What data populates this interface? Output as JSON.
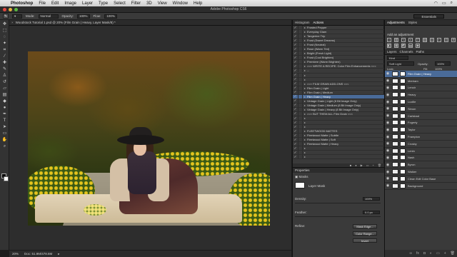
{
  "menubar": {
    "app_name": "Photoshop",
    "items": [
      "File",
      "Edit",
      "Image",
      "Layer",
      "Type",
      "Select",
      "Filter",
      "3D",
      "View",
      "Window",
      "Help"
    ]
  },
  "window": {
    "title": "Adobe Photoshop CS6"
  },
  "options_bar": {
    "mode_label": "Mode:",
    "mode_value": "Normal",
    "opacity_label": "Opacity:",
    "opacity_value": "100%",
    "flow_label": "Flow:",
    "flow_value": "100%",
    "workspace": "Essentials"
  },
  "document": {
    "tab_title": "Woodstock Tutorial 1.psd @ 20% (Film Grain | Heavy, Layer Mask/8) *"
  },
  "status_bar": {
    "zoom": "20%",
    "doc_size": "Doc: 51.9M/478.6M"
  },
  "actions_panel": {
    "tabs": [
      "Histogram",
      "Actions"
    ],
    "rows": [
      {
        "label": "Frosted Pepper"
      },
      {
        "label": "Everyday Glam"
      },
      {
        "label": "Tangerine Trip"
      },
      {
        "label": "Frost (Sweet Dreams)"
      },
      {
        "label": "Frost (Neutral)"
      },
      {
        "label": "Rose (Warm Tint)"
      },
      {
        "label": "Bright (Fresh Light)"
      },
      {
        "label": "Frost (Cool Brighten)"
      },
      {
        "label": "Premiere (Warm Brighten)"
      },
      {
        "label": ">>> WRITE A RECIPE: Color Film Enhancements <<<"
      },
      {
        "label": "..."
      },
      {
        "label": ""
      },
      {
        "label": ""
      },
      {
        "label": ">>> FILM GRAIN ADD-ONS <<<"
      },
      {
        "label": "Film Grain | Light"
      },
      {
        "label": "Film Grain | Medium"
      },
      {
        "label": "Film Grain | Heavy",
        "selected": true
      },
      {
        "label": "Vintage Grain | Light (8 Bit Image Only)"
      },
      {
        "label": "Vintage Grain | Medium (8 Bit Image Only)"
      },
      {
        "label": "Vintage Grain | Heavy (8 Bit Image Only)"
      },
      {
        "label": ">>> BUT THEM ALL Film Grain <<<"
      },
      {
        "label": ""
      },
      {
        "label": ""
      },
      {
        "label": ""
      },
      {
        "label": "FLEETWOOD MATTES"
      },
      {
        "label": "Fleetwood Matte | Subtle"
      },
      {
        "label": "Fleetwood Matte | Soft"
      },
      {
        "label": "Fleetwood Matte | Heavy"
      },
      {
        "label": ""
      },
      {
        "label": ""
      },
      {
        "label": ""
      }
    ]
  },
  "properties_panel": {
    "tab": "Properties",
    "title": "Masks",
    "mask_type": "Layer Mask",
    "density_label": "Density:",
    "density_value": "100%",
    "feather_label": "Feather:",
    "feather_value": "0.0 px",
    "refine_label": "Refine:",
    "buttons": [
      "Mask Edge...",
      "Color Range...",
      "Invert"
    ]
  },
  "adjustments_panel": {
    "tabs": [
      "Adjustments",
      "Styles"
    ],
    "title": "Add an adjustment"
  },
  "layers_panel": {
    "tabs": [
      "Layers",
      "Channels",
      "Paths"
    ],
    "kind_label": "Kind",
    "blend_mode": "Soft Light",
    "opacity_label": "Opacity:",
    "opacity_value": "100%",
    "lock_label": "Lock:",
    "fill_label": "Fill:",
    "fill_value": "100%",
    "layers": [
      {
        "name": "Film Grain | Heavy",
        "selected": true
      },
      {
        "name": "Merriam"
      },
      {
        "name": "Lenoir"
      },
      {
        "name": "Heavy"
      },
      {
        "name": "Lucille"
      },
      {
        "name": "Simon"
      },
      {
        "name": "Carlsbad"
      },
      {
        "name": "Fogerty"
      },
      {
        "name": "Taylor"
      },
      {
        "name": "Frampton"
      },
      {
        "name": "Crosby"
      },
      {
        "name": "Lenin"
      },
      {
        "name": "Nash"
      },
      {
        "name": "Byron"
      },
      {
        "name": "Walker"
      },
      {
        "name": "Clean Edit Color Base"
      },
      {
        "name": "Background"
      }
    ]
  },
  "colors": {
    "selection": "#4a6b99",
    "panel_bg": "#3a3a3a",
    "canvas_bg": "#2d2d2d"
  }
}
